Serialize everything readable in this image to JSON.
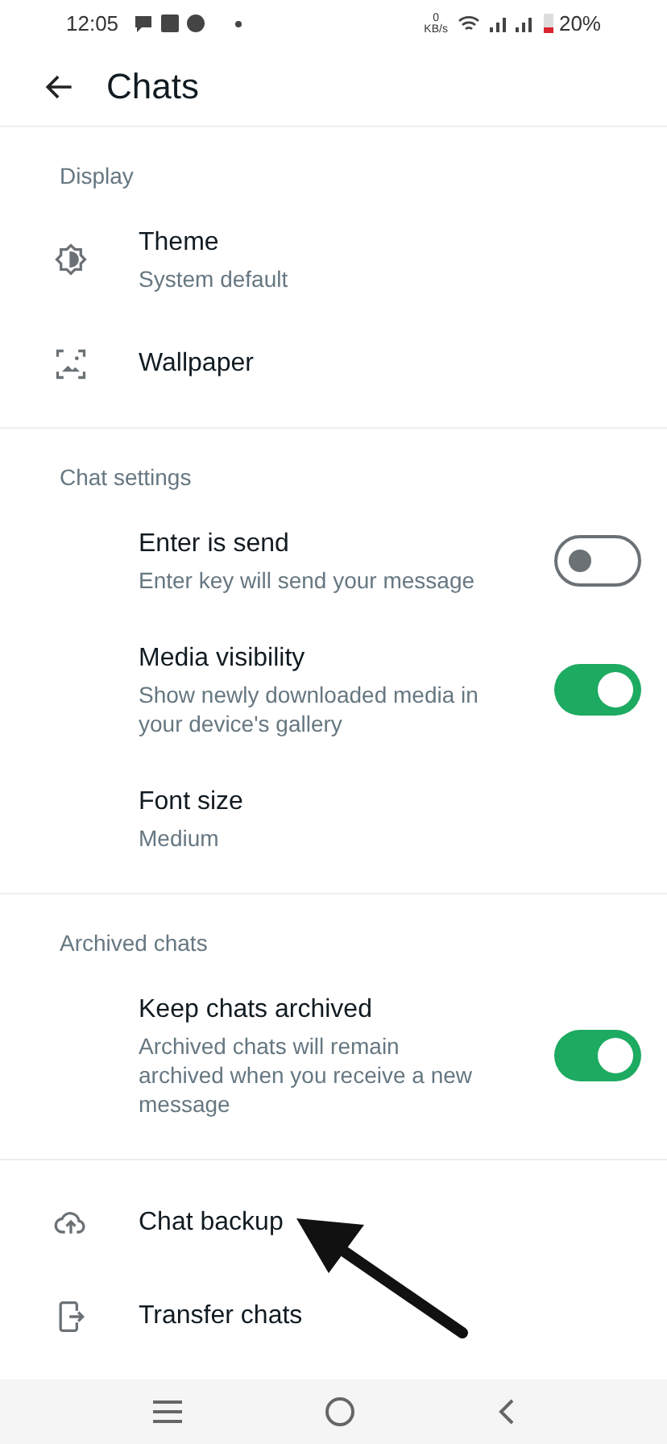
{
  "status_bar": {
    "time": "12:05",
    "net_speed_value": "0",
    "net_speed_unit": "KB/s",
    "battery": "20%"
  },
  "header": {
    "title": "Chats"
  },
  "sections": [
    {
      "title": "Display",
      "items": [
        {
          "kind": "icon",
          "title": "Theme",
          "subtitle": "System default"
        },
        {
          "kind": "icon",
          "title": "Wallpaper"
        }
      ]
    },
    {
      "title": "Chat settings",
      "items": [
        {
          "kind": "toggle",
          "title": "Enter is send",
          "subtitle": "Enter key will send your message",
          "on": false
        },
        {
          "kind": "toggle",
          "title": "Media visibility",
          "subtitle": "Show newly downloaded media in your device's gallery",
          "on": true
        },
        {
          "kind": "plain",
          "title": "Font size",
          "subtitle": "Medium"
        }
      ]
    },
    {
      "title": "Archived chats",
      "items": [
        {
          "kind": "toggle",
          "title": "Keep chats archived",
          "subtitle": "Archived chats will remain archived when you receive a new message",
          "on": true
        }
      ]
    },
    {
      "items": [
        {
          "kind": "icon",
          "title": "Chat backup"
        },
        {
          "kind": "icon",
          "title": "Transfer chats"
        }
      ]
    }
  ]
}
